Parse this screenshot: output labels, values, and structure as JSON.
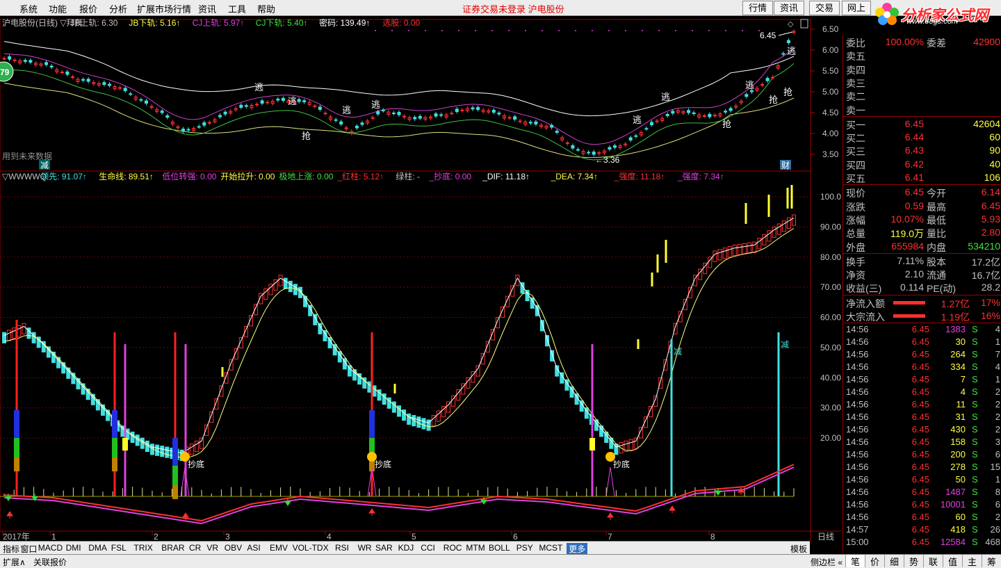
{
  "menu": [
    "系统",
    "功能",
    "报价",
    "分析",
    "扩展市场行情",
    "资讯",
    "工具",
    "帮助"
  ],
  "notice": "证券交易未登录  沪电股份",
  "right_tabs": [
    "行情",
    "资讯",
    "交易",
    "网上"
  ],
  "logo": {
    "title": "分析家公式网",
    "url": "www.88gs.com",
    "stock_code": "002463 沪电股份"
  },
  "main_legend": [
    {
      "text": "沪电股份(日线) ▽拜拜",
      "color": "#c0c0c0"
    },
    {
      "text": "JB上轨: 6.30",
      "color": "#c0c0c0"
    },
    {
      "text": "JB下轨: 5.16↑",
      "color": "#ffff40"
    },
    {
      "text": "CJ上轨: 5.97↑",
      "color": "#e040e0"
    },
    {
      "text": "CJ下轨: 5.40↑",
      "color": "#40e040"
    },
    {
      "text": "密码: 139.49↑",
      "color": "#ffffff"
    },
    {
      "text": "选股: 0.00",
      "color": "#ff3030"
    }
  ],
  "main_chart": {
    "y_ticks": [
      "6.50",
      "6.00",
      "5.50",
      "5.00",
      "4.50",
      "4.00",
      "3.50"
    ],
    "high_label": "6.45",
    "low_label": "3.36",
    "future_note": "用到未来数据",
    "badge": "79",
    "markers": {
      "escape": "逃",
      "grab": "抢",
      "reduce": "减",
      "finance": "财"
    }
  },
  "sub_legend": [
    {
      "text": "▽WWWWQ",
      "color": "#c0c0c0"
    },
    {
      "text": "领先: 91.07↑",
      "color": "#40e0e0"
    },
    {
      "text": "生命线: 89.51↑",
      "color": "#ffff40"
    },
    {
      "text": "低位转强: 0.00",
      "color": "#e040e0"
    },
    {
      "text": "开始拉升: 0.00",
      "color": "#ffff40"
    },
    {
      "text": "极地上涨: 0.00",
      "color": "#40e040"
    },
    {
      "text": "_红柱: 5.12↑",
      "color": "#ff3030"
    },
    {
      "text": "绿柱: -",
      "color": "#c0c0c0"
    },
    {
      "text": "_抄底: 0.00",
      "color": "#e040e0"
    },
    {
      "text": "_DIF: 11.18↑",
      "color": "#ffffff"
    },
    {
      "text": "_DEA: 7.34↑",
      "color": "#ffff40"
    },
    {
      "text": "_强度: 11.18↑",
      "color": "#ff3030"
    },
    {
      "text": "_强度: 7.34↑",
      "color": "#e040e0"
    }
  ],
  "sub_chart": {
    "y_ticks": [
      "100.0",
      "90.00",
      "80.00",
      "70.00",
      "60.00",
      "50.00",
      "40.00",
      "30.00",
      "20.00"
    ],
    "bottom_label": "抄底",
    "reduce_label": "减"
  },
  "x_axis": {
    "labels": [
      "2017年",
      "1",
      "2",
      "3",
      "4",
      "5",
      "6",
      "7",
      "8"
    ],
    "period": "日线"
  },
  "indicators": [
    "指标",
    "窗口",
    "MACD",
    "DMI",
    "DMA",
    "FSL",
    "TRIX",
    "BRAR",
    "CR",
    "VR",
    "OBV",
    "ASI",
    "EMV",
    "VOL-TDX",
    "RSI",
    "WR",
    "SAR",
    "KDJ",
    "CCI",
    "ROC",
    "MTM",
    "BOLL",
    "PSY",
    "MCST",
    "更多"
  ],
  "bottom_right": [
    "模板",
    "+",
    "−"
  ],
  "status_left": [
    "扩展∧",
    "关联报价"
  ],
  "status_right": {
    "sidebar": "侧边栏 «",
    "tabs": [
      "笔",
      "价",
      "细",
      "势",
      "联",
      "值",
      "主",
      "筹"
    ]
  },
  "quote": {
    "weibi": {
      "label": "委比",
      "value": "100.00%",
      "label2": "委差",
      "value2": "42900"
    },
    "sell": [
      {
        "label": "卖五",
        "price": "",
        "vol": ""
      },
      {
        "label": "卖四",
        "price": "",
        "vol": ""
      },
      {
        "label": "卖三",
        "price": "",
        "vol": ""
      },
      {
        "label": "卖二",
        "price": "",
        "vol": ""
      },
      {
        "label": "卖一",
        "price": "",
        "vol": ""
      }
    ],
    "buy": [
      {
        "label": "买一",
        "price": "6.45",
        "vol": "42604"
      },
      {
        "label": "买二",
        "price": "6.44",
        "vol": "60"
      },
      {
        "label": "买三",
        "price": "6.43",
        "vol": "90"
      },
      {
        "label": "买四",
        "price": "6.42",
        "vol": "40"
      },
      {
        "label": "买五",
        "price": "6.41",
        "vol": "106"
      }
    ],
    "stats": [
      {
        "l1": "现价",
        "v1": "6.45",
        "c1": "#ff3030",
        "l2": "今开",
        "v2": "6.14",
        "c2": "#ff3030"
      },
      {
        "l1": "涨跌",
        "v1": "0.59",
        "c1": "#ff3030",
        "l2": "最高",
        "v2": "6.45",
        "c2": "#ff3030"
      },
      {
        "l1": "涨幅",
        "v1": "10.07%",
        "c1": "#ff3030",
        "l2": "最低",
        "v2": "5.93",
        "c2": "#ff3030"
      },
      {
        "l1": "总量",
        "v1": "119.0万",
        "c1": "#ffff40",
        "l2": "量比",
        "v2": "2.80",
        "c2": "#ff3030"
      },
      {
        "l1": "外盘",
        "v1": "655984",
        "c1": "#ff3030",
        "l2": "内盘",
        "v2": "534210",
        "c2": "#40e040"
      }
    ],
    "stats2": [
      {
        "l1": "换手",
        "v1": "7.11%",
        "l2": "股本",
        "v2": "17.2亿"
      },
      {
        "l1": "净资",
        "v1": "2.10",
        "l2": "流通",
        "v2": "16.7亿"
      },
      {
        "l1": "收益(三)",
        "v1": "0.114",
        "l2": "PE(动)",
        "v2": "28.2"
      }
    ],
    "flows": [
      {
        "label": "净流入额",
        "value": "1.27亿",
        "pct": "17%"
      },
      {
        "label": "大宗流入",
        "value": "1.19亿",
        "pct": "16%"
      }
    ],
    "ticks": [
      {
        "t": "14:56",
        "p": "6.45",
        "v": "1383",
        "s": "S",
        "n": "4",
        "vc": "#e040e0"
      },
      {
        "t": "14:56",
        "p": "6.45",
        "v": "30",
        "s": "S",
        "n": "1",
        "vc": "#ffff40"
      },
      {
        "t": "14:56",
        "p": "6.45",
        "v": "264",
        "s": "S",
        "n": "7",
        "vc": "#ffff40"
      },
      {
        "t": "14:56",
        "p": "6.45",
        "v": "334",
        "s": "S",
        "n": "4",
        "vc": "#ffff40"
      },
      {
        "t": "14:56",
        "p": "6.45",
        "v": "7",
        "s": "S",
        "n": "1",
        "vc": "#ffff40"
      },
      {
        "t": "14:56",
        "p": "6.45",
        "v": "4",
        "s": "S",
        "n": "2",
        "vc": "#ffff40"
      },
      {
        "t": "14:56",
        "p": "6.45",
        "v": "11",
        "s": "S",
        "n": "2",
        "vc": "#ffff40"
      },
      {
        "t": "14:56",
        "p": "6.45",
        "v": "31",
        "s": "S",
        "n": "2",
        "vc": "#ffff40"
      },
      {
        "t": "14:56",
        "p": "6.45",
        "v": "430",
        "s": "S",
        "n": "2",
        "vc": "#ffff40"
      },
      {
        "t": "14:56",
        "p": "6.45",
        "v": "158",
        "s": "S",
        "n": "3",
        "vc": "#ffff40"
      },
      {
        "t": "14:56",
        "p": "6.45",
        "v": "200",
        "s": "S",
        "n": "6",
        "vc": "#ffff40"
      },
      {
        "t": "14:56",
        "p": "6.45",
        "v": "278",
        "s": "S",
        "n": "15",
        "vc": "#ffff40"
      },
      {
        "t": "14:56",
        "p": "6.45",
        "v": "50",
        "s": "S",
        "n": "1",
        "vc": "#ffff40"
      },
      {
        "t": "14:56",
        "p": "6.45",
        "v": "1487",
        "s": "S",
        "n": "8",
        "vc": "#e040e0"
      },
      {
        "t": "14:56",
        "p": "6.45",
        "v": "10001",
        "s": "S",
        "n": "6",
        "vc": "#e040e0"
      },
      {
        "t": "14:56",
        "p": "6.45",
        "v": "60",
        "s": "S",
        "n": "2",
        "vc": "#ffff40"
      },
      {
        "t": "14:57",
        "p": "6.45",
        "v": "418",
        "s": "S",
        "n": "26",
        "vc": "#ffff40"
      },
      {
        "t": "15:00",
        "p": "6.45",
        "v": "12584",
        "s": "S",
        "n": "468",
        "vc": "#e040e0"
      }
    ]
  },
  "colors": {
    "up": "#ff3030",
    "down": "#40e0e0",
    "grid": "#800000",
    "axis": "#c00000"
  }
}
